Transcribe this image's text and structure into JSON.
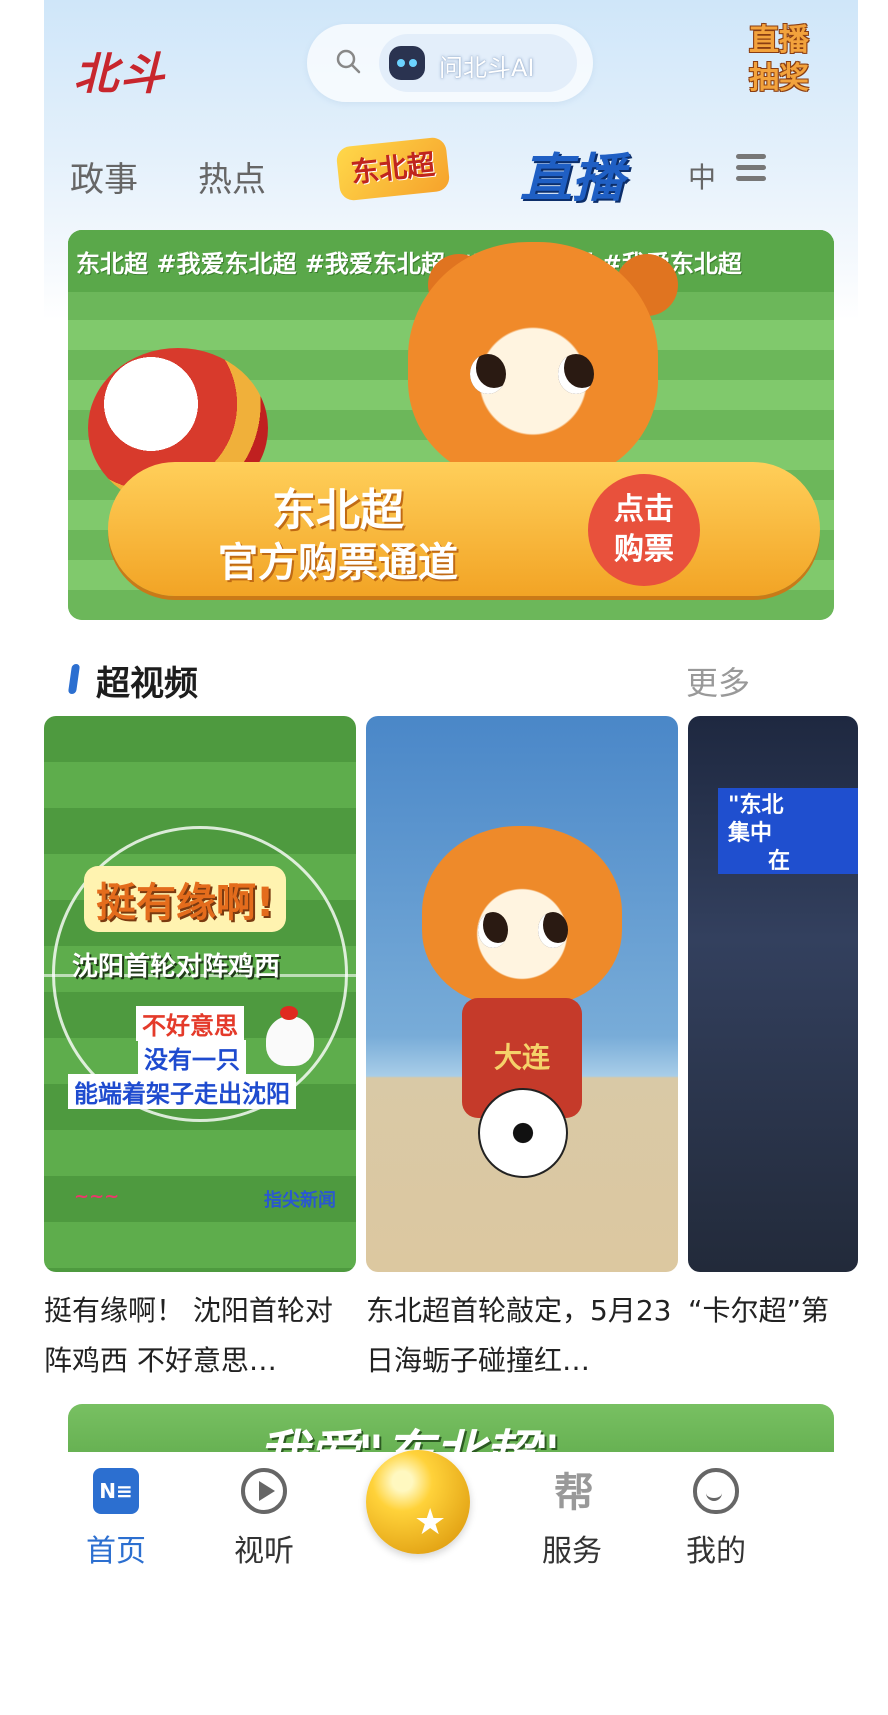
{
  "header": {
    "logo_text": "北斗",
    "search_ai_label": "问北斗AI",
    "lottery_line1": "直播",
    "lottery_line2": "抽奖"
  },
  "tabs": [
    {
      "label": "政事"
    },
    {
      "label": "热点"
    },
    {
      "label": "东北超"
    },
    {
      "label": "直播"
    },
    {
      "label": "中"
    }
  ],
  "banner": {
    "hashtags": "东北超 #我爱东北超 #我爱东北超 #我爱东北超 #我爱东北超",
    "title": "东北超",
    "subtitle": "官方购票通道",
    "button_line1": "点击",
    "button_line2": "购票"
  },
  "section": {
    "title": "超视频",
    "more": "更多"
  },
  "videos": [
    {
      "overlay_headline": "挺有缘啊!",
      "overlay_sub": "沈阳首轮对阵鸡西",
      "overlay_line1": "不好意思",
      "overlay_line2": "没有一只",
      "overlay_line3": "能端着架子走出沈阳",
      "logo_right": "指尖新闻",
      "caption": "挺有缘啊！ 沈阳首轮对阵鸡西 不好意思…"
    },
    {
      "jersey_text": "大连",
      "caption": "东北超首轮敲定，5月23日海蛎子碰撞红…"
    },
    {
      "sign_line1": "\"东北",
      "sign_line2": "集中",
      "sign_line3": "在",
      "caption": "“卡尔超”第"
    }
  ],
  "banner2": {
    "text": "我爱\"东北超\""
  },
  "nav": {
    "items": [
      {
        "label": "首页",
        "icon": "home-icon",
        "active": true
      },
      {
        "label": "视听",
        "icon": "play-icon",
        "active": false
      },
      {
        "label": "",
        "icon": "gold-coin-icon",
        "active": false
      },
      {
        "label": "服务",
        "icon": "service-icon",
        "active": false
      },
      {
        "label": "我的",
        "icon": "profile-icon",
        "active": false
      }
    ]
  },
  "colors": {
    "accent": "#2c6fd0",
    "logo_red": "#c8262d",
    "banner_green": "#7dc46a",
    "cta_orange": "#f2a425"
  }
}
